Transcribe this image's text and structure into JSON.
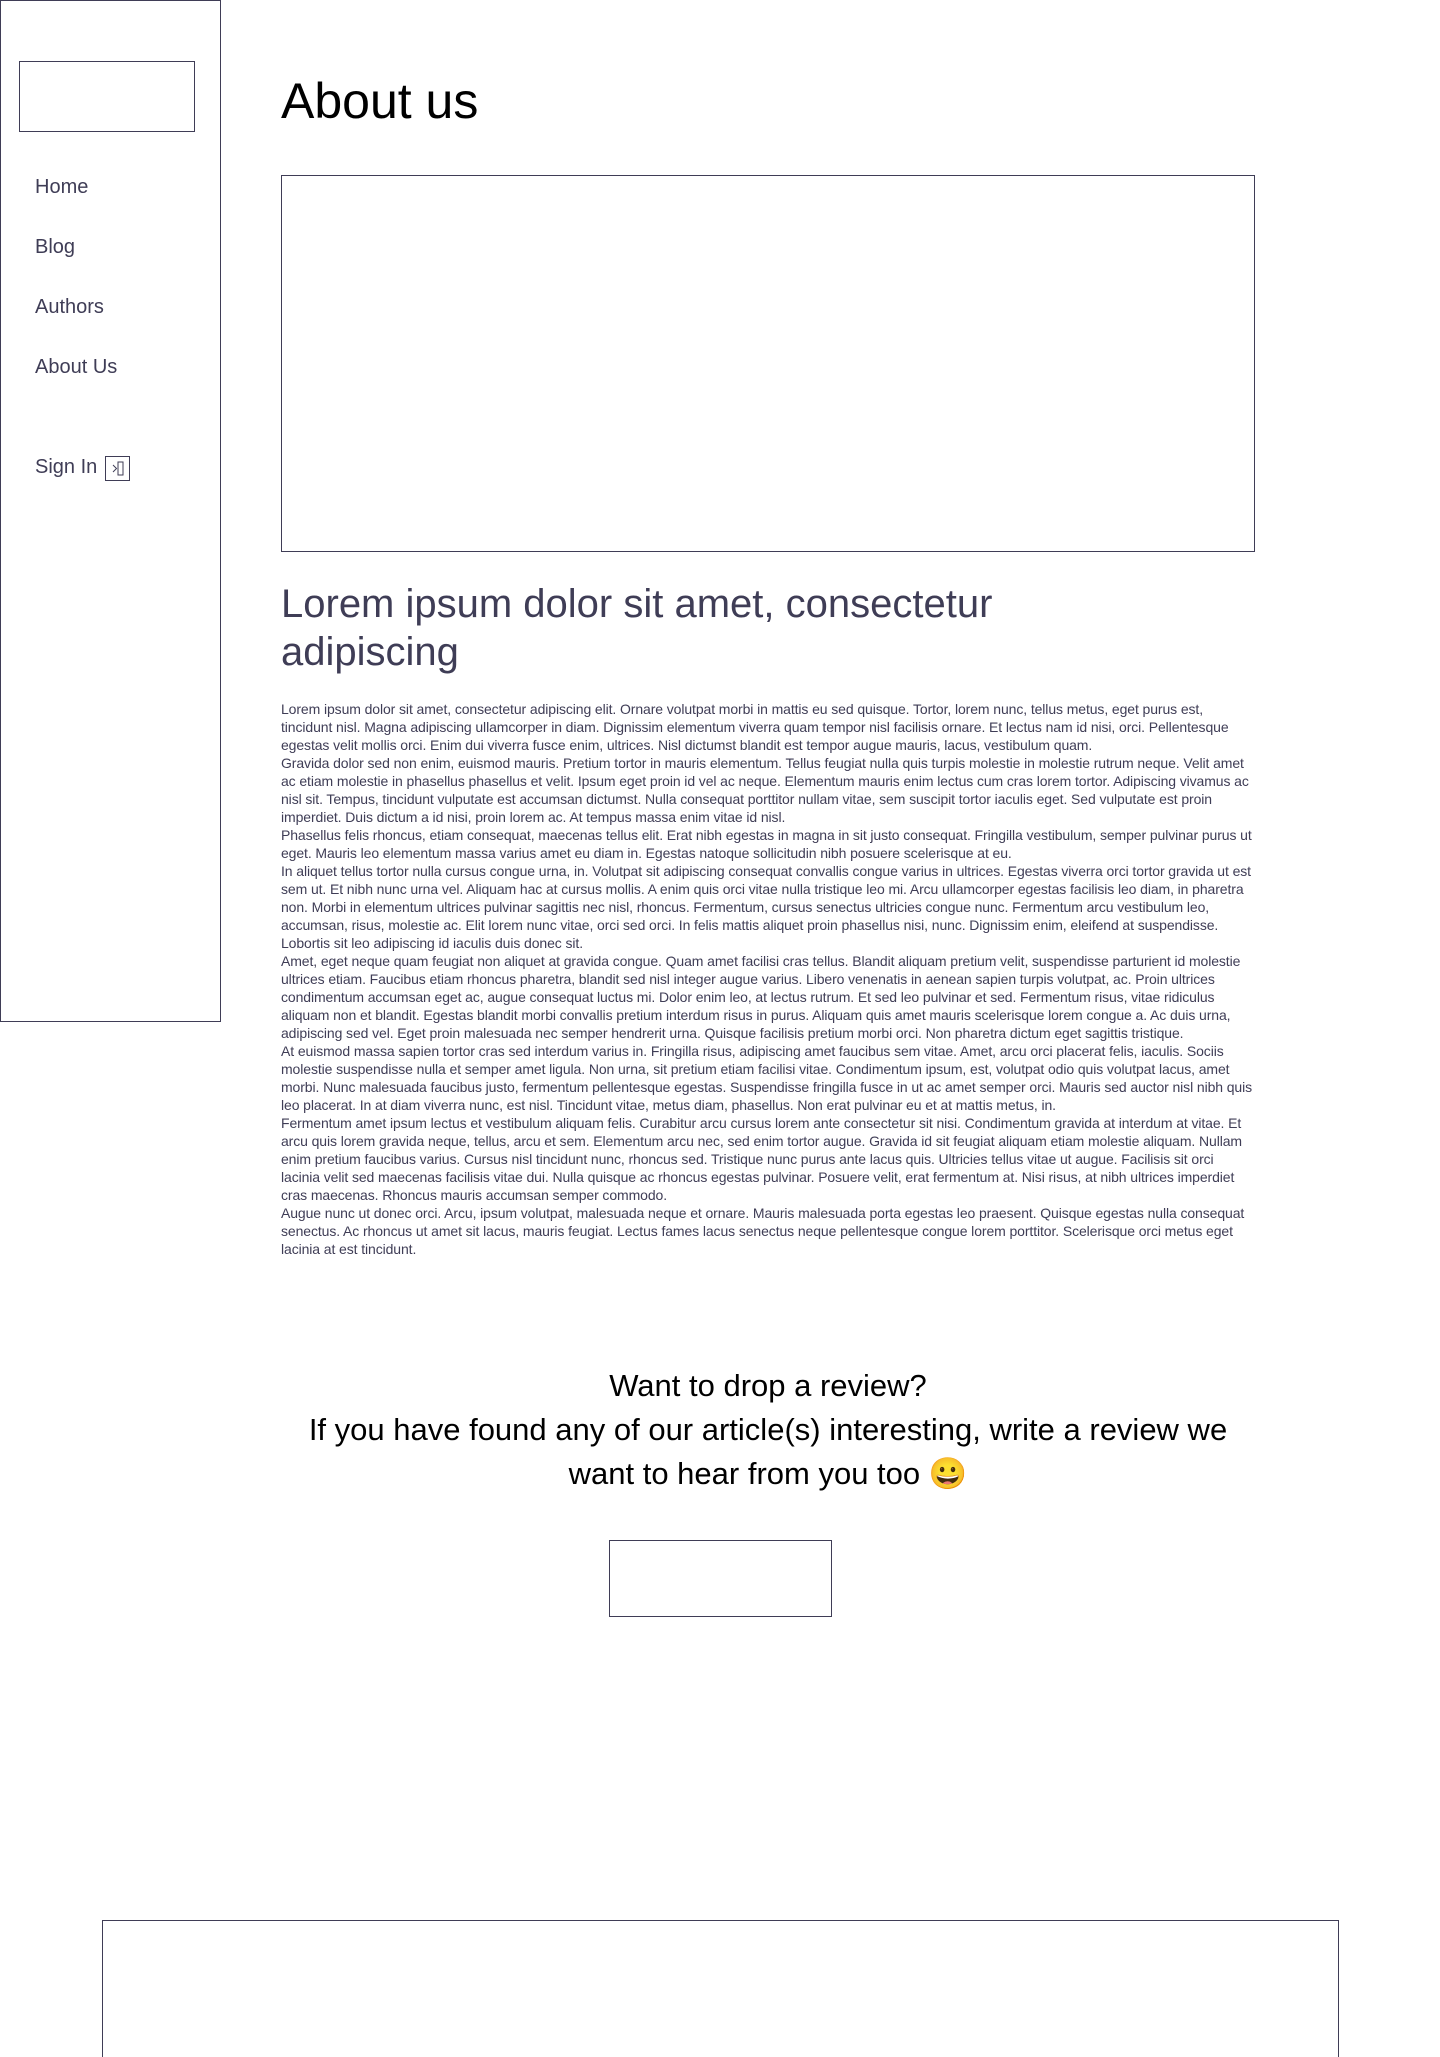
{
  "sidebar": {
    "nav": [
      {
        "label": "Home"
      },
      {
        "label": "Blog"
      },
      {
        "label": "Authors"
      },
      {
        "label": "About Us"
      }
    ],
    "signin_label": "Sign In",
    "signin_icon": "arrow-right-box-icon"
  },
  "main": {
    "title": "About us",
    "heading": "Lorem ipsum dolor sit amet, consectetur adipiscing",
    "paragraphs": [
      "Lorem ipsum dolor sit amet, consectetur adipiscing elit. Ornare volutpat morbi in mattis eu sed quisque. Tortor, lorem nunc, tellus metus, eget purus est, tincidunt nisl. Magna adipiscing ullamcorper in diam. Dignissim elementum viverra quam tempor nisl facilisis ornare. Et lectus nam id nisi, orci. Pellentesque egestas velit mollis orci. Enim dui viverra fusce enim, ultrices. Nisl dictumst blandit est tempor augue mauris, lacus, vestibulum quam.",
      "Gravida dolor sed non enim, euismod mauris. Pretium tortor in mauris elementum. Tellus feugiat nulla quis turpis molestie in molestie rutrum neque. Velit amet ac etiam molestie in phasellus phasellus et velit. Ipsum eget proin id vel ac neque. Elementum mauris enim lectus cum cras lorem tortor. Adipiscing vivamus ac nisl sit. Tempus, tincidunt vulputate est accumsan dictumst. Nulla consequat porttitor nullam vitae, sem suscipit tortor iaculis eget. Sed vulputate est proin imperdiet. Duis dictum a id nisi, proin lorem ac. At tempus massa enim vitae id nisl.",
      "Phasellus felis rhoncus, etiam consequat, maecenas tellus elit. Erat nibh egestas in magna in sit justo consequat. Fringilla vestibulum, semper pulvinar purus ut eget. Mauris leo elementum massa varius amet eu diam in. Egestas natoque sollicitudin nibh posuere scelerisque at eu.",
      "In aliquet tellus tortor nulla cursus congue urna, in. Volutpat sit adipiscing consequat convallis congue varius in ultrices. Egestas viverra orci tortor gravida ut est sem ut. Et nibh nunc urna vel. Aliquam hac at cursus mollis. A enim quis orci vitae nulla tristique leo mi. Arcu ullamcorper egestas facilisis leo diam, in pharetra non. Morbi in elementum ultrices pulvinar sagittis nec nisl, rhoncus. Fermentum, cursus senectus ultricies congue nunc. Fermentum arcu vestibulum leo, accumsan, risus, molestie ac. Elit lorem nunc vitae, orci sed orci. In felis mattis aliquet proin phasellus nisi, nunc. Dignissim enim, eleifend at suspendisse. Lobortis sit leo adipiscing id iaculis duis donec sit.",
      "Amet, eget neque quam feugiat non aliquet at gravida congue. Quam amet facilisi cras tellus. Blandit aliquam pretium velit, suspendisse parturient id molestie ultrices etiam. Faucibus etiam rhoncus pharetra, blandit sed nisl integer augue varius. Libero venenatis in aenean sapien turpis volutpat, ac. Proin ultrices condimentum accumsan eget ac, augue consequat luctus mi. Dolor enim leo, at lectus rutrum. Et sed leo pulvinar et sed. Fermentum risus, vitae ridiculus aliquam non et blandit. Egestas blandit morbi convallis pretium interdum risus in purus. Aliquam quis amet mauris scelerisque lorem congue a. Ac duis urna, adipiscing sed vel. Eget proin malesuada nec semper hendrerit urna. Quisque facilisis pretium morbi orci. Non pharetra dictum eget sagittis tristique.",
      "At euismod massa sapien tortor cras sed interdum varius in. Fringilla risus, adipiscing amet faucibus sem vitae. Amet, arcu orci placerat felis, iaculis. Sociis molestie suspendisse nulla et semper amet ligula. Non urna, sit pretium etiam facilisi vitae. Condimentum ipsum, est, volutpat odio quis volutpat lacus, amet morbi. Nunc malesuada faucibus justo, fermentum pellentesque egestas. Suspendisse fringilla fusce in ut ac amet semper orci. Mauris sed auctor nisl nibh quis leo placerat. In at diam viverra nunc, est nisl. Tincidunt vitae, metus diam, phasellus. Non erat pulvinar eu et at mattis metus, in.",
      "Fermentum amet ipsum lectus et vestibulum aliquam felis. Curabitur arcu cursus lorem ante consectetur sit nisi. Condimentum gravida at interdum at vitae. Et arcu quis lorem gravida neque, tellus, arcu et sem. Elementum arcu nec, sed enim tortor augue. Gravida id sit feugiat aliquam etiam molestie aliquam. Nullam enim pretium faucibus varius. Cursus nisl tincidunt nunc, rhoncus sed. Tristique nunc purus ante lacus quis. Ultricies tellus vitae ut augue. Facilisis sit orci lacinia velit sed maecenas facilisis vitae dui. Nulla quisque ac rhoncus egestas pulvinar. Posuere velit, erat fermentum at. Nisi risus, at nibh ultrices imperdiet cras maecenas. Rhoncus mauris accumsan semper commodo.",
      "Augue nunc ut donec orci. Arcu, ipsum volutpat, malesuada neque et ornare. Mauris malesuada porta egestas leo praesent. Quisque egestas nulla consequat senectus. Ac rhoncus ut amet sit lacus, mauris feugiat. Lectus fames lacus senectus neque pellentesque congue lorem porttitor. Scelerisque orci metus eget lacinia at est tincidunt."
    ]
  },
  "review": {
    "line1": "Want to drop a review?",
    "line2": "If you have found any of our article(s) interesting, write a review we want to hear from you too 😀"
  },
  "colors": {
    "primary_text": "#3f3d56",
    "border": "#3f3d56"
  }
}
